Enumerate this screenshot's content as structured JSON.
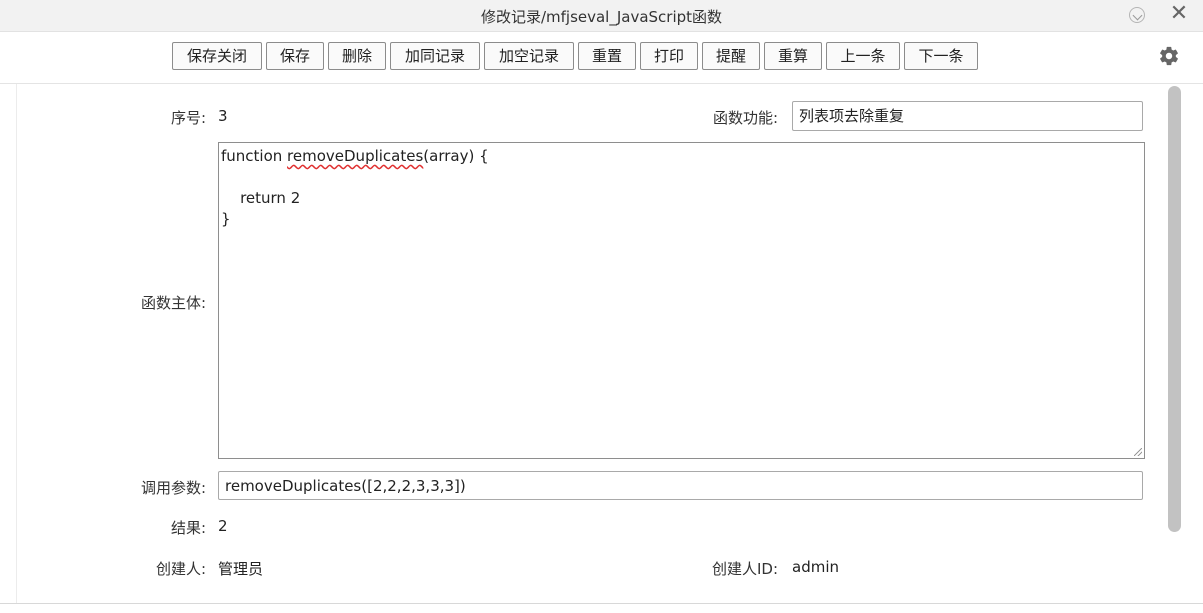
{
  "window": {
    "title": "修改记录/mfjseval_JavaScript函数",
    "restore_icon": "restore-icon",
    "close_icon": "close-icon",
    "close_glyph": "✕"
  },
  "toolbar": {
    "buttons": [
      {
        "label": "保存关闭"
      },
      {
        "label": "保存"
      },
      {
        "label": "删除"
      },
      {
        "label": "加同记录"
      },
      {
        "label": "加空记录"
      },
      {
        "label": "重置"
      },
      {
        "label": "打印"
      },
      {
        "label": "提醒"
      },
      {
        "label": "重算"
      },
      {
        "label": "上一条"
      },
      {
        "label": "下一条"
      }
    ],
    "settings_icon": "gear-icon"
  },
  "form": {
    "seq_label": "序号:",
    "seq_value": "3",
    "func_purpose_label": "函数功能:",
    "func_purpose_value": "列表项去除重复",
    "func_body_label": "函数主体:",
    "func_body_lines": [
      {
        "prefix": "function ",
        "squiggle": "removeDuplicates",
        "suffix": "(array) {"
      },
      {
        "text": ""
      },
      {
        "text": "    return 2"
      },
      {
        "text": "}"
      }
    ],
    "call_params_label": "调用参数:",
    "call_params_value": "removeDuplicates([2,2,2,3,3,3])",
    "result_label": "结果:",
    "result_value": "2",
    "creator_label": "创建人:",
    "creator_value": "管理员",
    "creator_id_label": "创建人ID:",
    "creator_id_value": "admin"
  }
}
